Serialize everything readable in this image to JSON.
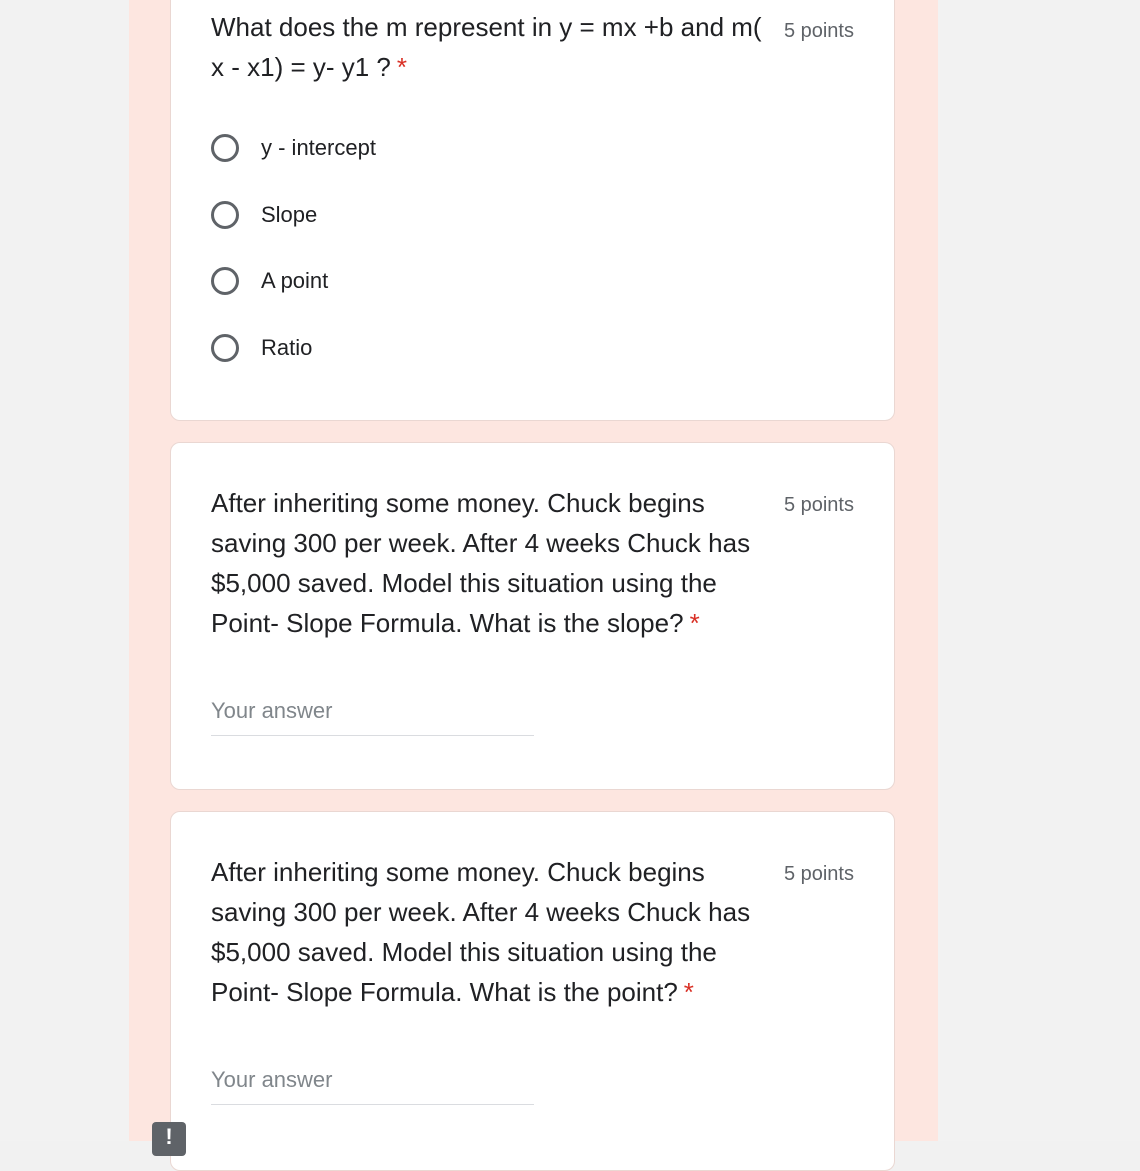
{
  "questions": [
    {
      "text": "What does the m represent in y = mx +b and m( x - x1) = y- y1 ?",
      "required_mark": "*",
      "points": "5 points",
      "options": [
        "y - intercept",
        "Slope",
        "A point",
        "Ratio"
      ]
    },
    {
      "text": "After inheriting some money. Chuck begins saving 300 per week. After 4 weeks Chuck has $5,000 saved. Model this situation using the Point- Slope Formula. What is the slope?",
      "required_mark": "*",
      "points": "5 points",
      "answer_placeholder": "Your answer",
      "answer_value": ""
    },
    {
      "text": "After inheriting some money. Chuck begins saving 300 per week. After 4 weeks Chuck has $5,000 saved. Model this situation using the Point- Slope Formula. What is the point?",
      "required_mark": "*",
      "points": "5 points",
      "answer_placeholder": "Your answer",
      "answer_value": ""
    }
  ],
  "report_button_glyph": "!",
  "colors": {
    "form_background": "#fde6e0",
    "card_background": "#ffffff",
    "required_star": "#d93025",
    "radio_border": "#5f6368"
  }
}
